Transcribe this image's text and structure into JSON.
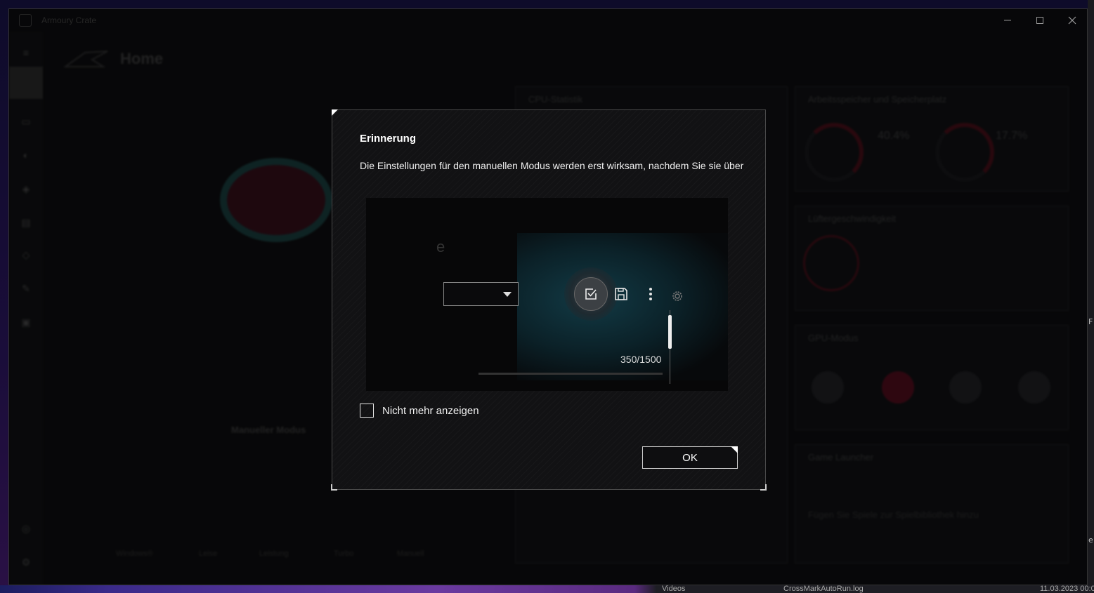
{
  "window": {
    "app_title": "Armoury Crate",
    "minimize_icon": "minimize-icon",
    "maximize_icon": "maximize-icon",
    "close_icon": "close-icon"
  },
  "background_app": {
    "page_title": "Home",
    "panels": {
      "cpu_stats": "CPU-Statistik",
      "memory": "Arbeitsspeicher und Speicherplatz",
      "fan_speed": "Lüftergeschwindigkeit",
      "gpu_modes": "GPU-Modus",
      "game_launcher": "Game Launcher"
    },
    "gauges": [
      {
        "value": "40.4%"
      },
      {
        "value": "17.7%"
      }
    ],
    "mode_label": "Manueller Modus",
    "bottom_tabs": [
      "Windows®",
      "Leise",
      "Leistung",
      "Turbo",
      "Manuell"
    ],
    "launcher_hint": "Fügen Sie Spiele zur Spielbibliothek hinzu"
  },
  "dialog": {
    "title": "Erinnerung",
    "message": "Die Einstellungen für den manuellen Modus werden erst wirksam, nachdem Sie sie über",
    "preview": {
      "partial_label": "e",
      "apply_icon": "apply-check-icon",
      "save_icon": "save-icon",
      "more_icon": "more-vertical-icon",
      "settings_icon": "gear-icon",
      "value_text": "350/1500"
    },
    "checkbox_label": "Nicht mehr anzeigen",
    "checkbox_checked": false,
    "ok_label": "OK"
  },
  "taskbar": {
    "item1": "Videos",
    "item2": "CrossMarkAutoRun.log",
    "datetime": "11.03.2023 00:0"
  },
  "desktop_edge": [
    "F",
    "e"
  ]
}
